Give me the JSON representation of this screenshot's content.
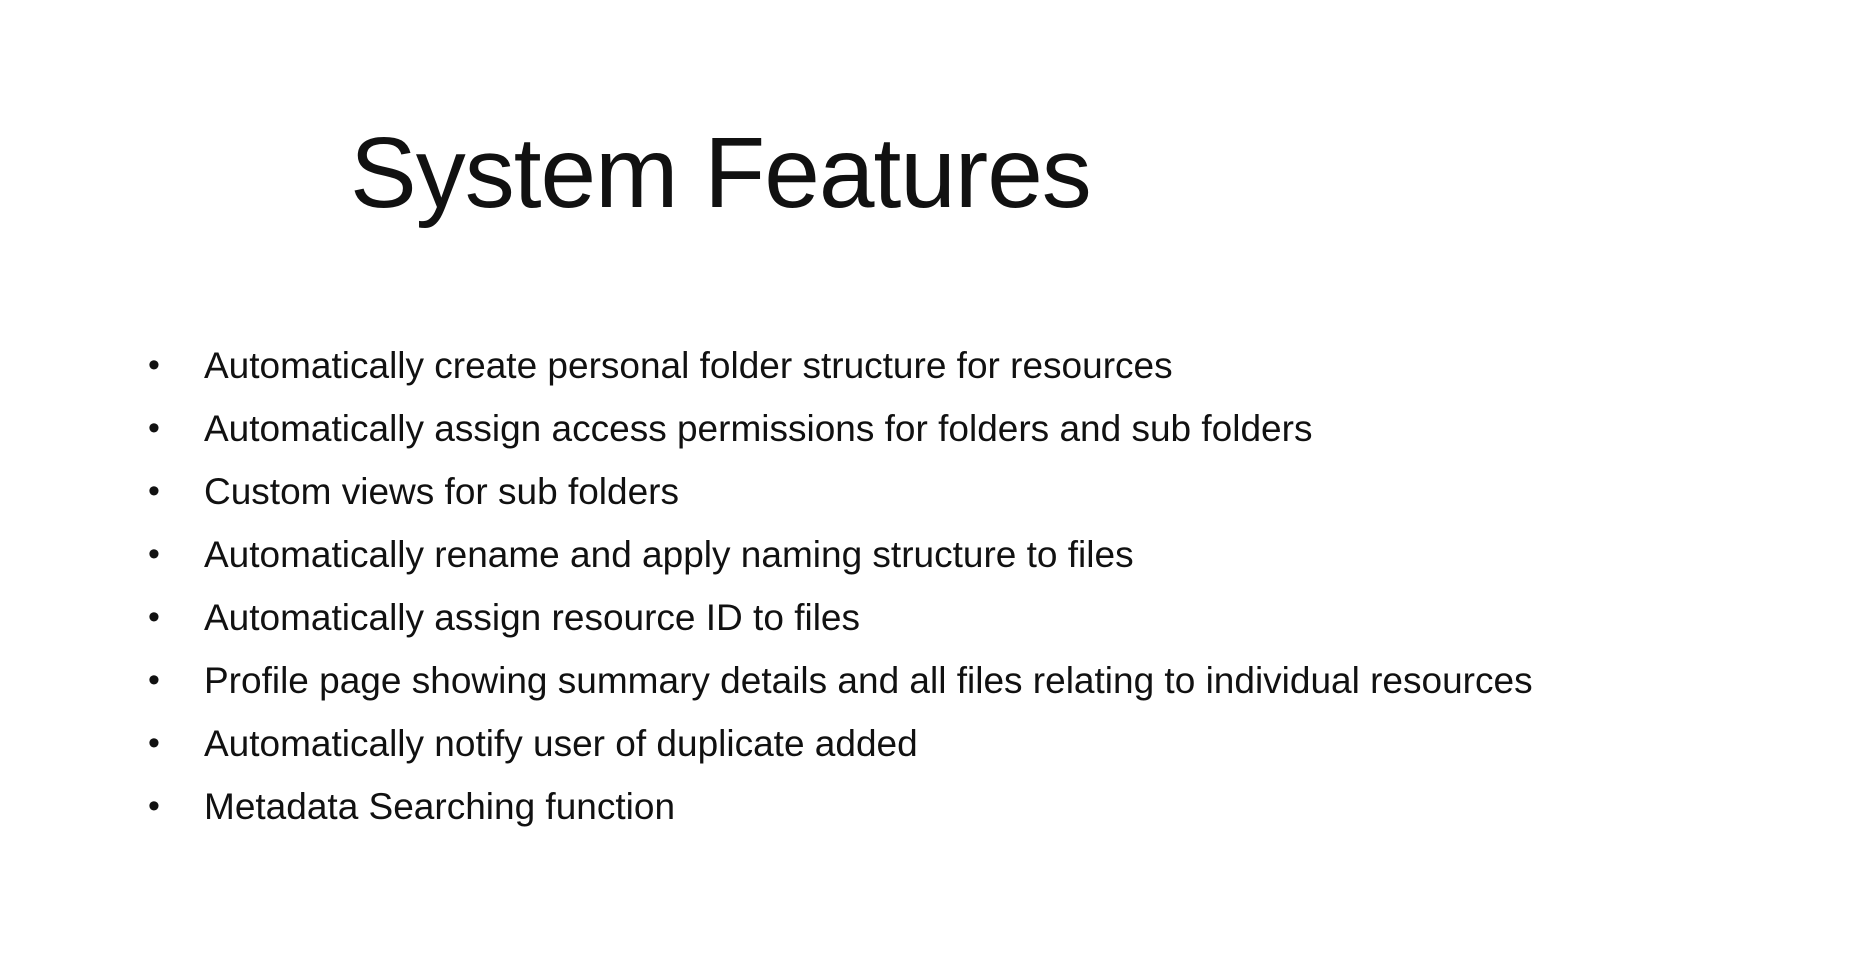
{
  "slide": {
    "title": "System Features",
    "bullet_symbol": "•",
    "bullets": [
      "Automatically create personal folder structure for resources",
      "Automatically assign access permissions for folders and sub folders",
      "Custom views for sub folders",
      "Automatically rename and apply naming structure to files",
      "Automatically assign resource ID to files",
      "Profile page showing summary details and all files relating to individual resources",
      "Automatically notify user of duplicate added",
      "Metadata Searching function"
    ]
  }
}
